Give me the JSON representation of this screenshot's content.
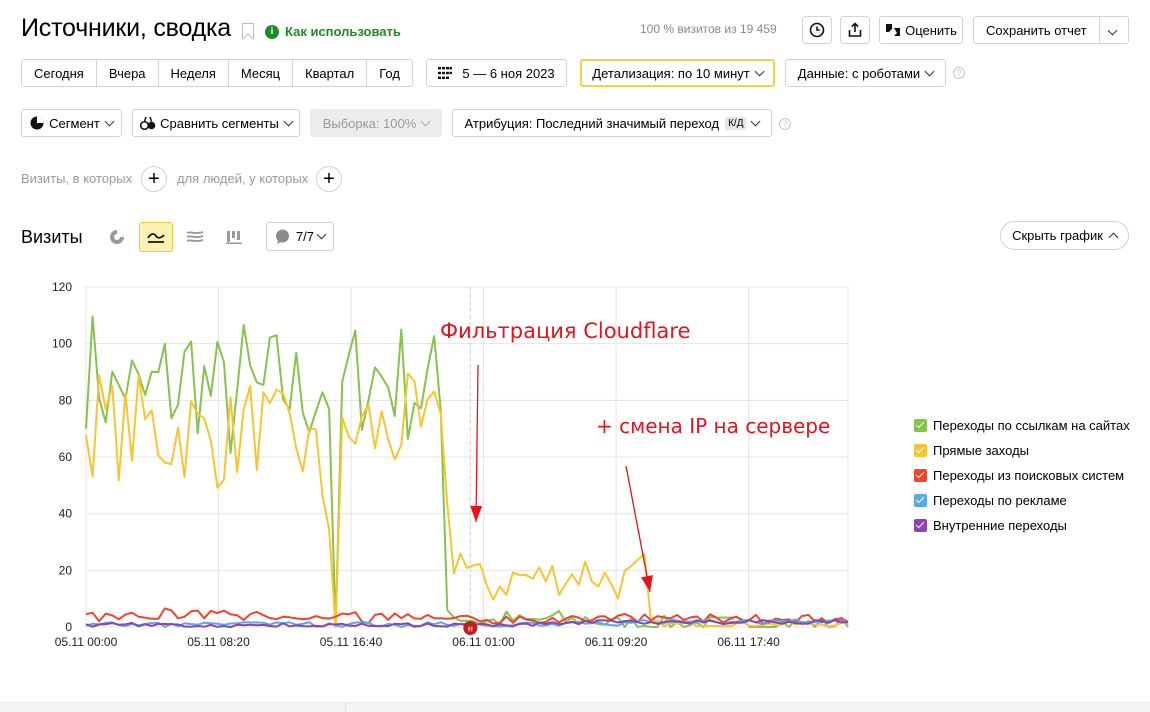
{
  "header": {
    "title": "Источники, сводка",
    "how_to_use": "Как использовать",
    "visits_pct": "100 % визитов из 19 459",
    "rate_label": "Оценить",
    "save_report_label": "Сохранить отчет"
  },
  "period": {
    "buttons": [
      "Сегодня",
      "Вчера",
      "Неделя",
      "Месяц",
      "Квартал",
      "Год"
    ],
    "date_range": "5 — 6 ноя 2023",
    "detail": "Детализация: по 10 минут",
    "data": "Данные: с роботами"
  },
  "segments": {
    "segment": "Сегмент",
    "compare": "Сравнить сегменты",
    "sample": "Выборка: 100%",
    "attribution": "Атрибуция: Последний значимый переход",
    "attribution_badge": "К/Д"
  },
  "filters": {
    "visits_where": "Визиты, в которых",
    "people_where": "для людей, у которых"
  },
  "chart_section": {
    "title": "Визиты",
    "series_counter": "7/7",
    "hide_chart": "Скрыть график"
  },
  "colors": {
    "green": "#86c34c",
    "yellow": "#f7c531",
    "red": "#f0442d",
    "blue": "#5aa8e6",
    "purple": "#8e44ad",
    "annotation": "#e5141b"
  },
  "chart_data": {
    "type": "line",
    "y_ticks": [
      0,
      20,
      40,
      60,
      80,
      100,
      120
    ],
    "ylim": [
      0,
      120
    ],
    "x_ticks": [
      "05.11 00:00",
      "05.11 08:20",
      "05.11 16:40",
      "06.11 01:00",
      "06.11 09:20",
      "06.11 17:40"
    ],
    "grid": true,
    "legend_position": "right",
    "event_marker": "н",
    "series": [
      {
        "name": "Переходы по ссылкам на сайтах",
        "color": "#86c34c",
        "profile": [
          [
            0,
            92
          ],
          [
            2,
            90
          ],
          [
            4,
            80
          ],
          [
            6,
            88
          ],
          [
            8,
            78
          ],
          [
            10,
            82
          ],
          [
            12,
            86
          ],
          [
            14,
            84
          ],
          [
            16,
            92
          ],
          [
            18,
            84
          ],
          [
            20,
            82
          ],
          [
            22,
            78
          ],
          [
            24,
            88
          ],
          [
            26,
            80
          ],
          [
            28,
            84
          ],
          [
            30,
            86
          ],
          [
            32,
            82
          ],
          [
            34,
            84
          ],
          [
            36,
            86
          ],
          [
            37,
            86
          ],
          [
            38,
            0
          ],
          [
            39,
            84
          ],
          [
            41,
            88
          ],
          [
            43,
            90
          ],
          [
            45,
            88
          ],
          [
            47,
            88
          ],
          [
            49,
            86
          ],
          [
            51,
            84
          ],
          [
            53,
            84
          ],
          [
            54,
            76
          ],
          [
            55,
            8
          ],
          [
            56,
            4
          ],
          [
            58,
            3
          ],
          [
            60,
            2
          ],
          [
            62,
            2
          ],
          [
            64,
            3
          ],
          [
            66,
            2
          ],
          [
            68,
            2
          ],
          [
            70,
            3
          ],
          [
            72,
            3
          ],
          [
            74,
            2
          ],
          [
            76,
            3
          ],
          [
            78,
            2
          ],
          [
            80,
            1
          ],
          [
            83,
            1
          ],
          [
            86,
            1
          ],
          [
            90,
            1
          ],
          [
            95,
            1
          ],
          [
            100,
            1
          ],
          [
            106,
            1
          ],
          [
            112,
            1
          ],
          [
            116,
            1
          ]
        ]
      },
      {
        "name": "Прямые заходы",
        "color": "#f7c531",
        "profile": [
          [
            0,
            68
          ],
          [
            2,
            74
          ],
          [
            4,
            70
          ],
          [
            6,
            68
          ],
          [
            8,
            72
          ],
          [
            10,
            70
          ],
          [
            12,
            68
          ],
          [
            14,
            68
          ],
          [
            16,
            70
          ],
          [
            18,
            66
          ],
          [
            20,
            66
          ],
          [
            22,
            66
          ],
          [
            24,
            70
          ],
          [
            26,
            72
          ],
          [
            28,
            66
          ],
          [
            30,
            66
          ],
          [
            32,
            66
          ],
          [
            34,
            62
          ],
          [
            36,
            50
          ],
          [
            37,
            44
          ],
          [
            38,
            0
          ],
          [
            39,
            60
          ],
          [
            41,
            70
          ],
          [
            43,
            70
          ],
          [
            45,
            68
          ],
          [
            47,
            70
          ],
          [
            49,
            72
          ],
          [
            51,
            66
          ],
          [
            53,
            68
          ],
          [
            54,
            86
          ],
          [
            55,
            38
          ],
          [
            56,
            32
          ],
          [
            58,
            20
          ],
          [
            60,
            16
          ],
          [
            62,
            14
          ],
          [
            64,
            16
          ],
          [
            66,
            18
          ],
          [
            68,
            17
          ],
          [
            70,
            18
          ],
          [
            72,
            18
          ],
          [
            74,
            18
          ],
          [
            76,
            20
          ],
          [
            78,
            18
          ],
          [
            80,
            16
          ],
          [
            82,
            16
          ],
          [
            84,
            18
          ],
          [
            85,
            20
          ],
          [
            86,
            2
          ],
          [
            88,
            1
          ],
          [
            92,
            1
          ],
          [
            100,
            1
          ],
          [
            106,
            1
          ],
          [
            112,
            1
          ],
          [
            116,
            1
          ]
        ]
      },
      {
        "name": "Переходы из поисковых систем",
        "color": "#f0442d",
        "profile": [
          [
            0,
            2
          ],
          [
            4,
            2
          ],
          [
            8,
            2
          ],
          [
            12,
            3
          ],
          [
            16,
            2
          ],
          [
            20,
            3
          ],
          [
            24,
            2
          ],
          [
            28,
            2
          ],
          [
            32,
            3
          ],
          [
            36,
            2
          ],
          [
            40,
            2
          ],
          [
            44,
            1
          ],
          [
            48,
            2
          ],
          [
            52,
            1
          ],
          [
            56,
            1
          ],
          [
            60,
            1
          ],
          [
            64,
            1
          ],
          [
            68,
            1
          ],
          [
            72,
            1
          ],
          [
            76,
            1
          ],
          [
            80,
            1
          ],
          [
            84,
            1
          ],
          [
            88,
            1
          ],
          [
            92,
            1
          ],
          [
            96,
            1
          ],
          [
            100,
            1
          ],
          [
            104,
            1
          ],
          [
            108,
            1
          ],
          [
            112,
            1
          ],
          [
            116,
            1
          ]
        ]
      },
      {
        "name": "Переходы по рекламе",
        "color": "#5aa8e6",
        "profile": [
          [
            0,
            0
          ],
          [
            40,
            0
          ],
          [
            60,
            0
          ],
          [
            80,
            0
          ],
          [
            88,
            1
          ],
          [
            92,
            1
          ],
          [
            96,
            1
          ],
          [
            100,
            1
          ],
          [
            104,
            1
          ],
          [
            108,
            1
          ],
          [
            112,
            1
          ],
          [
            116,
            1
          ]
        ]
      },
      {
        "name": "Внутренние переходы",
        "color": "#8e44ad",
        "profile": [
          [
            0,
            0
          ],
          [
            40,
            0
          ],
          [
            60,
            0
          ],
          [
            80,
            1
          ],
          [
            86,
            1
          ],
          [
            90,
            1
          ],
          [
            94,
            1
          ],
          [
            98,
            1
          ],
          [
            102,
            1
          ],
          [
            106,
            1
          ],
          [
            110,
            1
          ],
          [
            116,
            1
          ]
        ]
      }
    ],
    "annotations": [
      {
        "text": "Фильтрация Cloudflare",
        "color": "#e5141b"
      },
      {
        "text": "+ смена IP на сервере",
        "color": "#e5141b"
      }
    ]
  }
}
